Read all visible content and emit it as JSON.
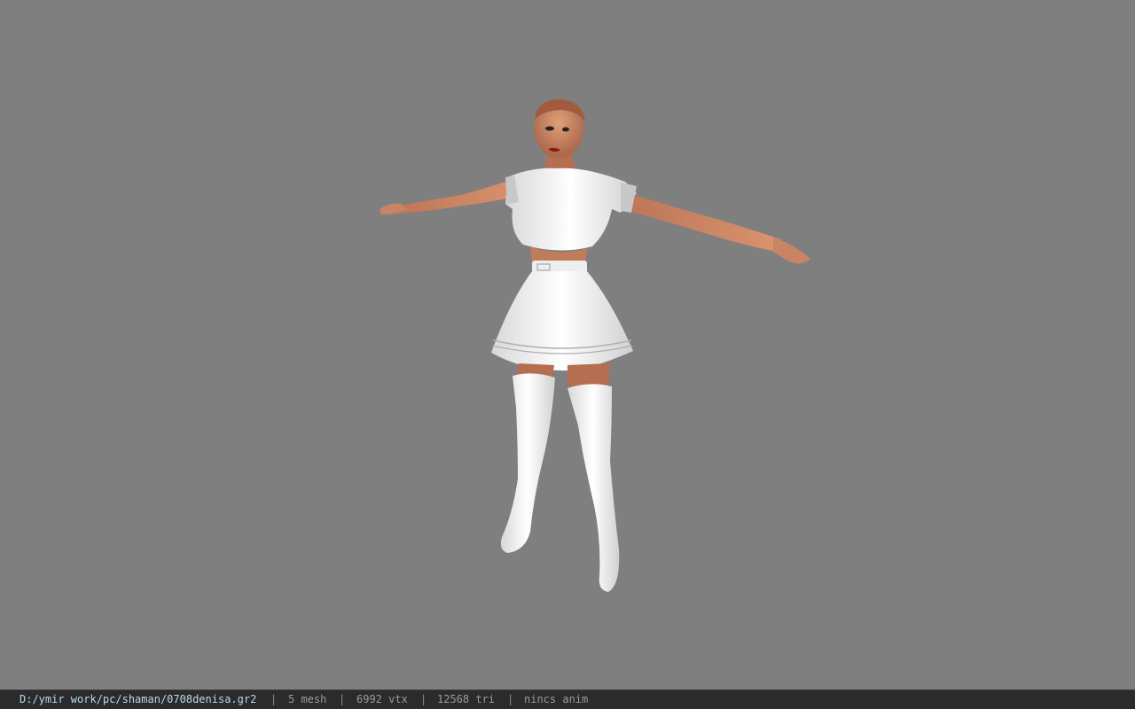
{
  "viewport": {
    "background_color": "#7f7f7f",
    "model_description_icon": "character-model"
  },
  "status_bar": {
    "file_path": "D:/ymir work/pc/shaman/0708denisa.gr2",
    "separator": "|",
    "mesh_count": "5 mesh",
    "vertex_count": "6992 vtx",
    "triangle_count": "12568 tri",
    "animation_status": "nincs anim"
  }
}
